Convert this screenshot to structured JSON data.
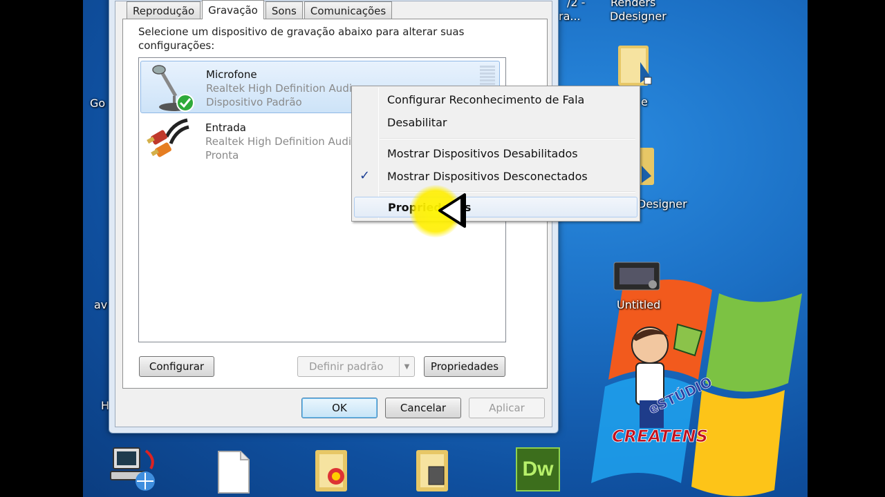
{
  "dialog": {
    "tabs": [
      "Reprodução",
      "Gravação",
      "Sons",
      "Comunicações"
    ],
    "active_tab": "Gravação",
    "instructions": "Selecione um dispositivo de gravação abaixo para alterar suas configurações:",
    "devices": [
      {
        "name": "Microfone",
        "driver": "Realtek High Definition Audio",
        "status": "Dispositivo Padrão",
        "selected": true
      },
      {
        "name": "Entrada",
        "driver": "Realtek High Definition Audio",
        "status": "Pronta",
        "selected": false
      }
    ],
    "buttons": {
      "configure": "Configurar",
      "set_default": "Definir padrão",
      "properties": "Propriedades",
      "ok": "OK",
      "cancel": "Cancelar",
      "apply": "Aplicar"
    }
  },
  "context_menu": {
    "items": [
      {
        "label": "Configurar Reconhecimento de Fala",
        "checked": false
      },
      {
        "label": "Desabilitar",
        "checked": false
      },
      {
        "label": "Mostrar Dispositivos Desabilitados",
        "checked": false
      },
      {
        "label": "Mostrar Dispositivos Desconectados",
        "checked": true
      },
      {
        "label": "Propriedades",
        "checked": false,
        "bold": true,
        "hover": true
      }
    ]
  },
  "desktop": {
    "labels": {
      "renders_line1": "Renders",
      "renders_line2": "Ddesigner",
      "designer": "Designer",
      "untitled": "Untitled",
      "partial_top": "/2 -",
      "partial_top2": "ra...",
      "partial_go": "Go",
      "partial_av": "av",
      "partial_h": "H",
      "partial_e": "e"
    },
    "watermark": {
      "line1": "eSTÚDIO",
      "line2": "CREATENS"
    },
    "taskbar_dw_label": "Dw"
  },
  "colors": {
    "desktop_blue": "#1b6fc4",
    "selection_blue": "#cde3f8",
    "checkmark_blue": "#1c3f94",
    "highlight_yellow": "#fff000"
  }
}
